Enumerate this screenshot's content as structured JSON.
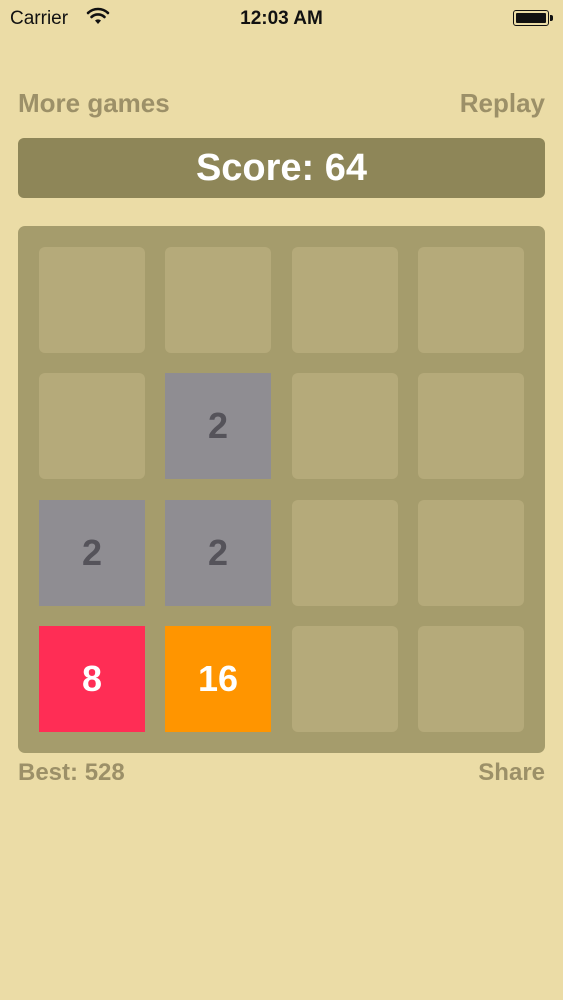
{
  "status_bar": {
    "carrier": "Carrier",
    "time": "12:03 AM"
  },
  "header": {
    "more_games": "More games",
    "replay": "Replay"
  },
  "score": {
    "label": "Score: ",
    "value": "64"
  },
  "board": {
    "tiles": {
      "r1c1": "2",
      "r2c0": "2",
      "r2c1": "2",
      "r3c0": "8",
      "r3c1": "16"
    }
  },
  "footer": {
    "best_label": "Best: ",
    "best_value": "528",
    "share": "Share"
  },
  "colors": {
    "background": "#ebdca6",
    "score_bar": "#8e8658",
    "board": "#a59c6c",
    "empty_cell": "#b5aa7a",
    "tile_2": "#8f8d92",
    "tile_8": "#ff2d55",
    "tile_16": "#ff9500",
    "link_text": "#9c9068"
  }
}
